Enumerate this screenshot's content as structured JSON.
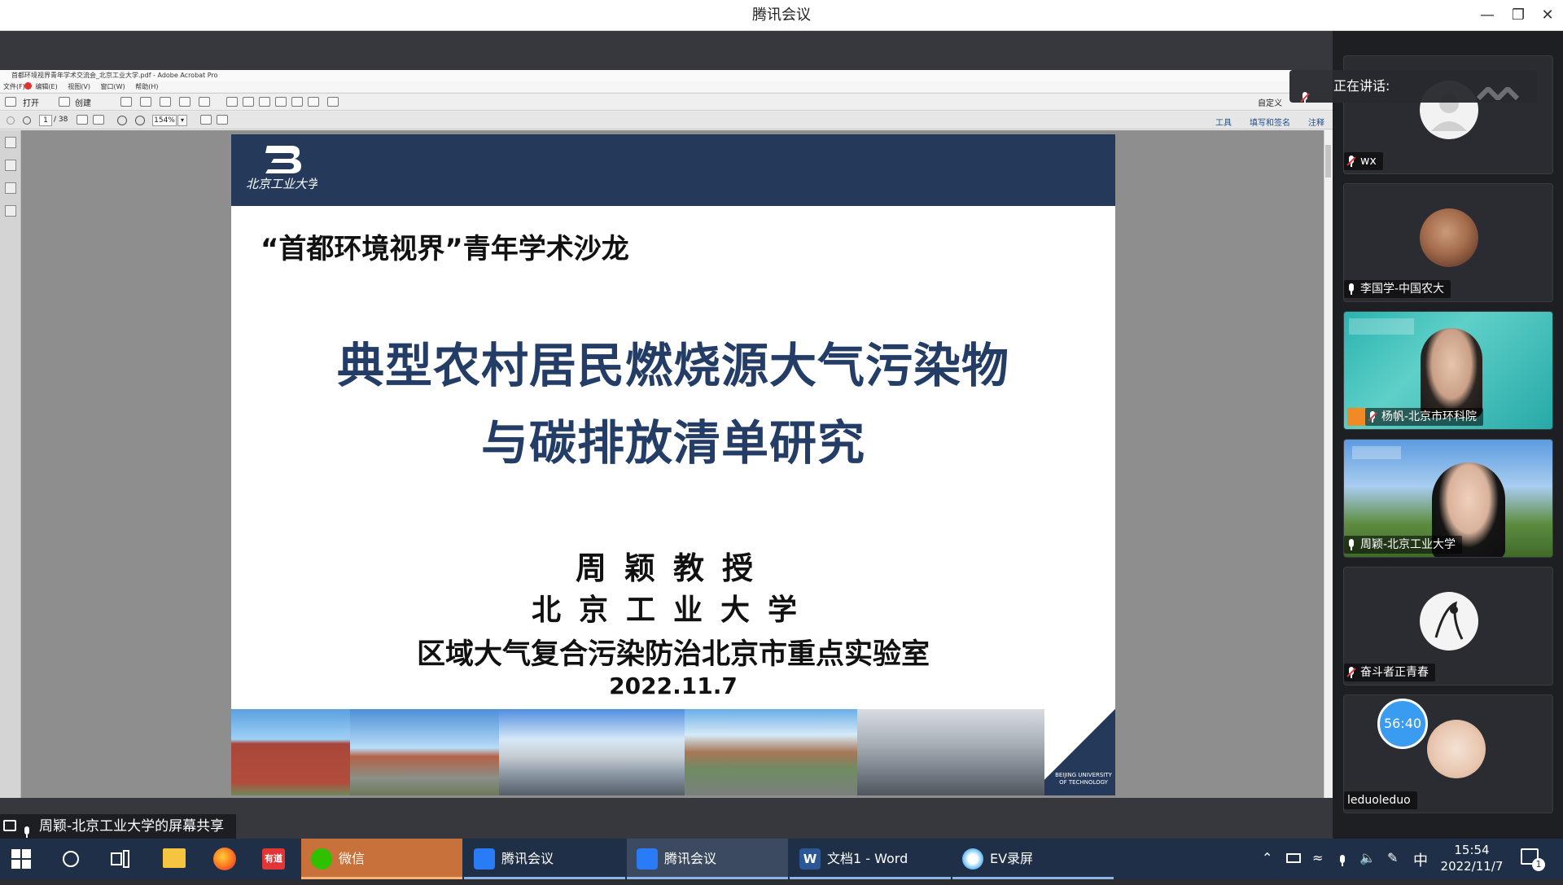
{
  "window": {
    "title": "腾讯会议",
    "minimize_icon": "minimize-icon",
    "restore_icon": "restore-icon",
    "close_icon": "close-icon"
  },
  "acrobat": {
    "title": "首都环境视界青年学术交流会_北京工业大学.pdf - Adobe Acrobat Pro",
    "menu": [
      "文件(F)",
      "编辑(E)",
      "视图(V)",
      "窗口(W)",
      "帮助(H)"
    ],
    "toolbar": {
      "open_label": "打开",
      "create_label": "创建",
      "customize_label": "自定义"
    },
    "nav": {
      "page_value": "1",
      "page_total": "/ 38",
      "zoom_value": "154%",
      "tools_label": "工具",
      "sign_label": "填写和签名",
      "comment_label": "注释"
    }
  },
  "slide": {
    "salon_title": "“首都环境视界”青年学术沙龙",
    "main_title_line1": "典型农村居民燃烧源大气污染物",
    "main_title_line2": "与碳排放清单研究",
    "presenter": "周颖教授",
    "university": "北京工业大学",
    "lab": "区域大气复合污染防治北京市重点实验室",
    "date": "2022.11.7",
    "logo_text": "北京工业大学",
    "footer_logo_text": "BEIJING UNIVERSITY OF TECHNOLOGY"
  },
  "speaking": {
    "label": "正在讲话:"
  },
  "participants": [
    {
      "name": "wx",
      "muted": true
    },
    {
      "name": "李国学-中国农大",
      "muted": false
    },
    {
      "name": "杨帆-北京市环科院",
      "muted": true
    },
    {
      "name": "周颖-北京工业大学",
      "muted": false
    },
    {
      "name": "奋斗者正青春",
      "muted": true
    },
    {
      "name": "leduoleduo",
      "muted": false
    }
  ],
  "timer": "56:40",
  "share_status": "周颖-北京工业大学的屏幕共享",
  "taskbar": {
    "apps": [
      {
        "label": "微信",
        "icon": "wechat-icon"
      },
      {
        "label": "腾讯会议",
        "icon": "tencent-meeting-icon"
      },
      {
        "label": "腾讯会议",
        "icon": "tencent-meeting-icon"
      },
      {
        "label": "文档1 - Word",
        "icon": "word-icon"
      },
      {
        "label": "EV录屏",
        "icon": "ev-recorder-icon"
      }
    ],
    "pinned": {
      "youdao_label": "有道"
    },
    "tray": {
      "ime": "中",
      "time": "15:54",
      "date": "2022/11/7",
      "notification_count": "1"
    }
  }
}
